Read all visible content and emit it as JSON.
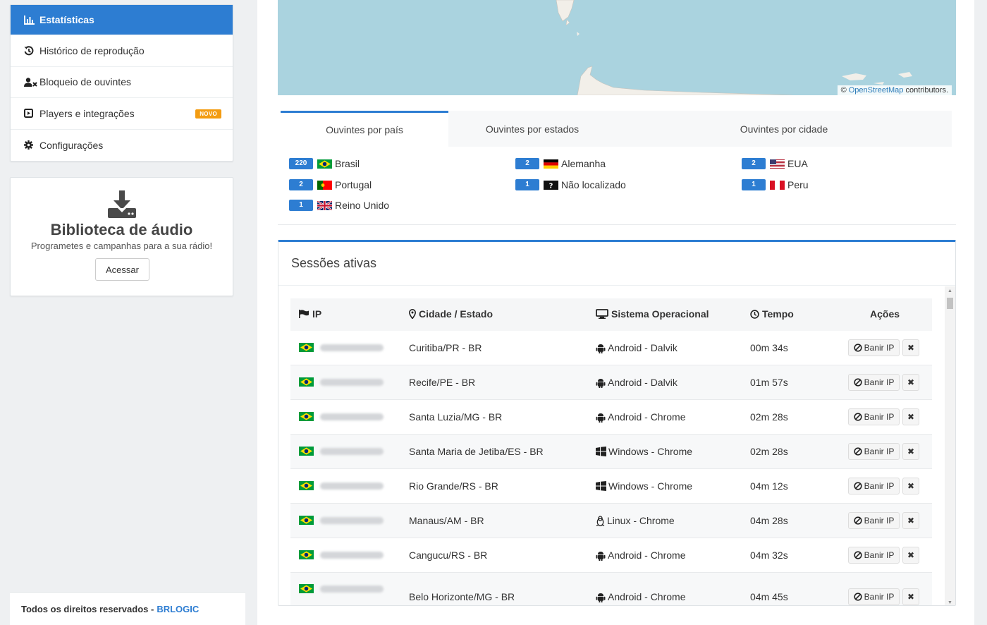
{
  "sidebar": {
    "items": [
      {
        "label": "Estatísticas",
        "icon": "bar-chart-icon",
        "active": true
      },
      {
        "label": "Histórico de reprodução",
        "icon": "history-icon"
      },
      {
        "label": "Bloqueio de ouvintes",
        "icon": "user-block-icon"
      },
      {
        "label": "Players e integrações",
        "icon": "play-square-icon",
        "badge": "NOVO"
      },
      {
        "label": "Configurações",
        "icon": "gear-icon"
      }
    ],
    "library": {
      "title": "Biblioteca de áudio",
      "subtitle": "Programetes e campanhas para a sua rádio!",
      "button": "Acessar"
    },
    "footer": {
      "text": "Todos os direitos reservados -",
      "brand": "BRLOGIC"
    }
  },
  "map": {
    "attribution_prefix": "©",
    "attribution_link": "OpenStreetMap",
    "attribution_suffix": "contributors."
  },
  "tabs": [
    "Ouvintes por país",
    "Ouvintes por estados",
    "Ouvintes por cidade"
  ],
  "countries": [
    {
      "count": "220",
      "name": "Brasil",
      "flag": "br"
    },
    {
      "count": "2",
      "name": "Alemanha",
      "flag": "de"
    },
    {
      "count": "2",
      "name": "EUA",
      "flag": "us"
    },
    {
      "count": "2",
      "name": "Portugal",
      "flag": "pt"
    },
    {
      "count": "1",
      "name": "Não localizado",
      "flag": "unknown"
    },
    {
      "count": "1",
      "name": "Peru",
      "flag": "pe"
    },
    {
      "count": "1",
      "name": "Reino Unido",
      "flag": "gb"
    }
  ],
  "sessions": {
    "title": "Sessões ativas",
    "headers": {
      "ip": "IP",
      "city": "Cidade / Estado",
      "os": "Sistema Operacional",
      "time": "Tempo",
      "actions": "Ações"
    },
    "ban_label": "Banir IP",
    "rows": [
      {
        "city": "Curitiba/PR - BR",
        "os": "Android - Dalvik",
        "os_icon": "android-icon",
        "time": "00m 34s"
      },
      {
        "city": "Recife/PE - BR",
        "os": "Android - Dalvik",
        "os_icon": "android-icon",
        "time": "01m 57s"
      },
      {
        "city": "Santa Luzia/MG - BR",
        "os": "Android - Chrome",
        "os_icon": "android-icon",
        "time": "02m 28s"
      },
      {
        "city": "Santa Maria de Jetiba/ES - BR",
        "os": "Windows - Chrome",
        "os_icon": "windows-icon",
        "time": "02m 28s"
      },
      {
        "city": "Rio Grande/RS - BR",
        "os": "Windows - Chrome",
        "os_icon": "windows-icon",
        "time": "04m 12s"
      },
      {
        "city": "Manaus/AM - BR",
        "os": "Linux - Chrome",
        "os_icon": "linux-icon",
        "time": "04m 28s"
      },
      {
        "city": "Cangucu/RS - BR",
        "os": "Android - Chrome",
        "os_icon": "android-icon",
        "time": "04m 32s"
      },
      {
        "city": "Belo Horizonte/MG - BR",
        "os": "Android - Chrome",
        "os_icon": "android-icon",
        "time": "04m 45s"
      }
    ]
  },
  "colors": {
    "accent": "#2d7dd2",
    "badge": "#f39c12",
    "map_water": "#aad3df"
  }
}
